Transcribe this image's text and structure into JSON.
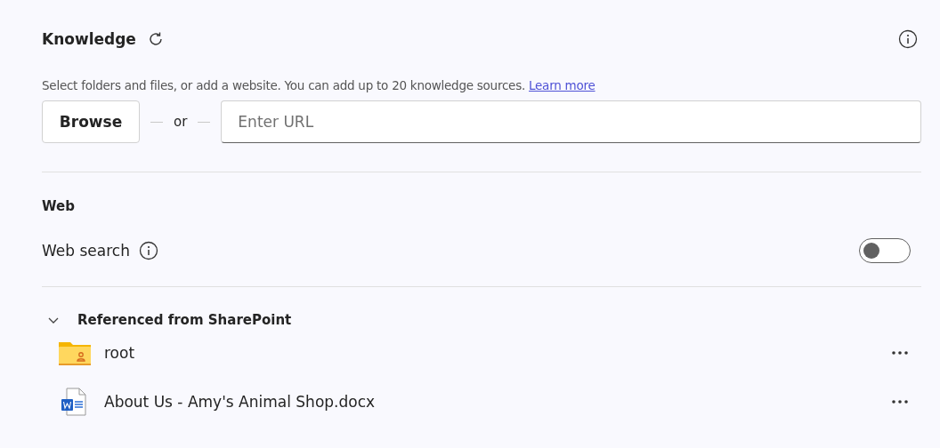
{
  "header": {
    "title": "Knowledge"
  },
  "description": {
    "text": "Select folders and files, or add a website. You can add up to 20 knowledge sources.",
    "link": "Learn more"
  },
  "add_row": {
    "browse": "Browse",
    "separator": "or",
    "url_field": {
      "placeholder": "Enter URL"
    }
  },
  "web": {
    "heading": "Web",
    "search_label": "Web search",
    "toggle": {
      "on": false
    }
  },
  "group": {
    "title": "Referenced from SharePoint",
    "expanded": true,
    "items": [
      {
        "kind": "folder",
        "name": "root"
      },
      {
        "kind": "doc",
        "name": "About Us - Amy's Animal Shop.docx"
      }
    ]
  }
}
